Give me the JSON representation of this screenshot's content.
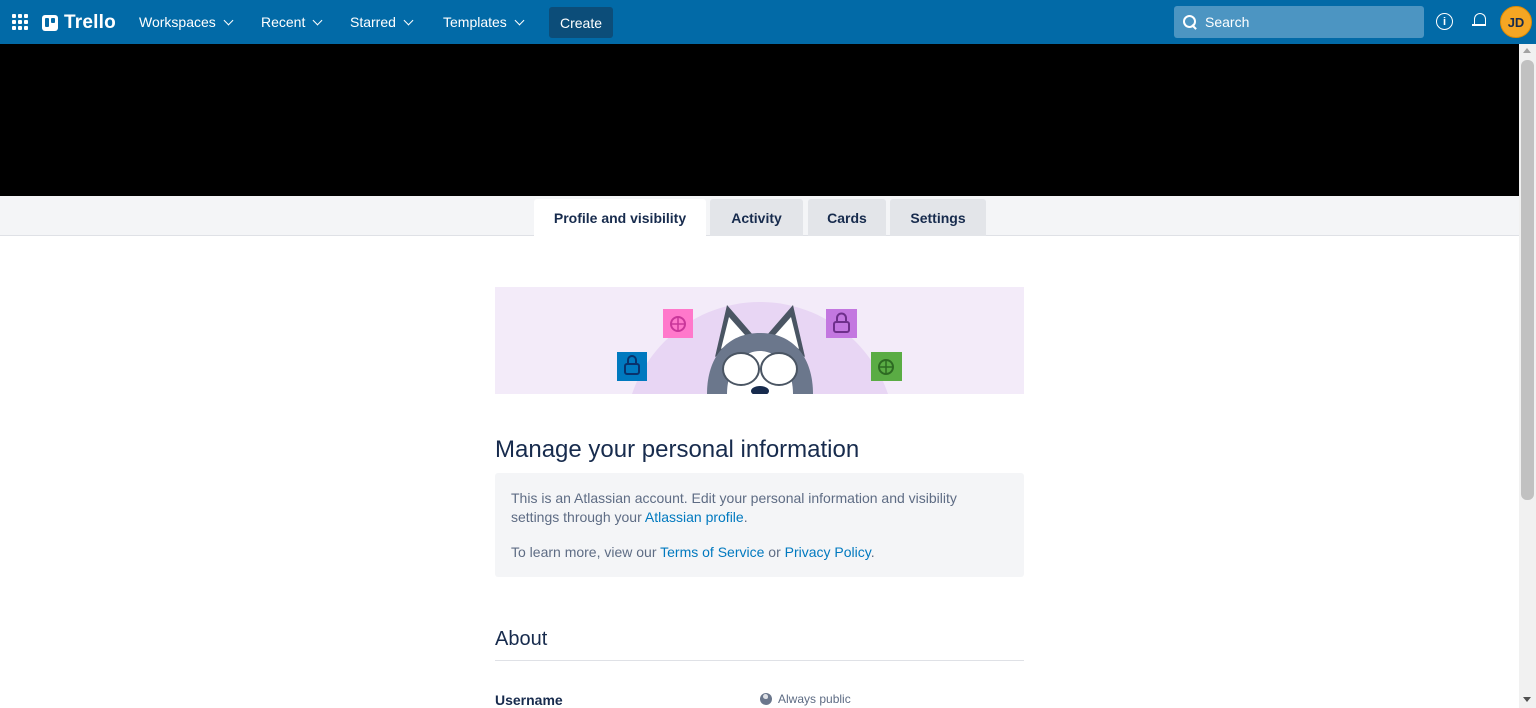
{
  "app": {
    "name": "Trello"
  },
  "nav": {
    "workspaces": "Workspaces",
    "recent": "Recent",
    "starred": "Starred",
    "templates": "Templates",
    "create": "Create"
  },
  "search": {
    "placeholder": "Search"
  },
  "user": {
    "initials": "JD"
  },
  "tabs": [
    {
      "label": "Profile and visibility",
      "active": true
    },
    {
      "label": "Activity"
    },
    {
      "label": "Cards"
    },
    {
      "label": "Settings"
    }
  ],
  "main": {
    "title": "Manage your personal information",
    "notice": {
      "line1_prefix": "This is an Atlassian account. Edit your personal information and visibility settings through your ",
      "atlassian_link": "Atlassian profile",
      "line1_suffix": ".",
      "line2_prefix": "To learn more, view our ",
      "tos_link": "Terms of Service",
      "line2_mid": " or ",
      "privacy_link": "Privacy Policy",
      "line2_suffix": "."
    },
    "about_title": "About",
    "username_label": "Username",
    "username_visibility": "Always public"
  },
  "colors": {
    "topbar": "#026aa7",
    "link": "#0079bf",
    "avatar": "#f5a623",
    "illustration_bg": "#f3ebf9"
  },
  "icons": [
    "app-switcher-icon",
    "trello-logo-icon",
    "search-icon",
    "info-icon",
    "bell-icon",
    "globe-icon"
  ]
}
